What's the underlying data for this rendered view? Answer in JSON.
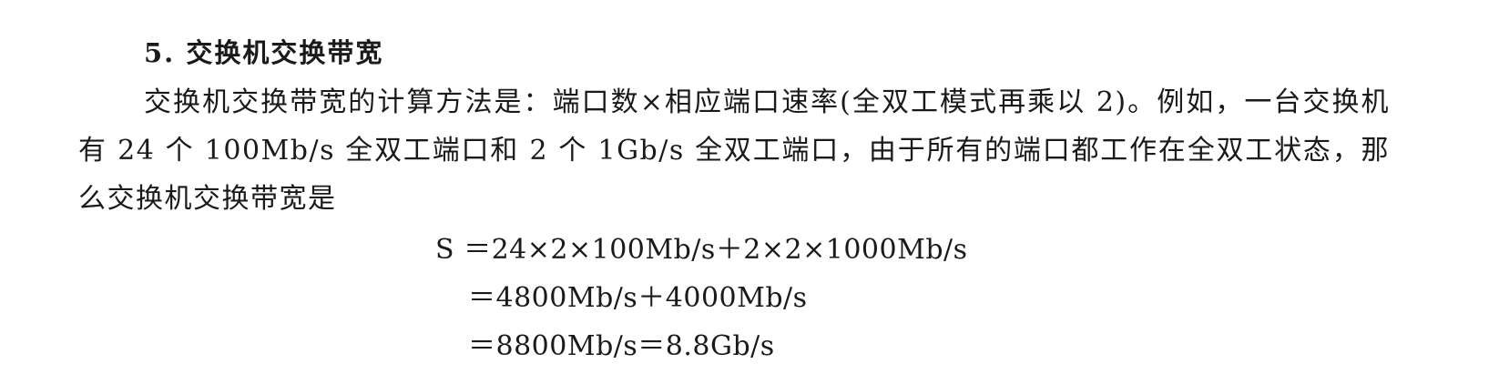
{
  "section": {
    "heading": "5. 交换机交换带宽",
    "paragraph": "交换机交换带宽的计算方法是：端口数×相应端口速率(全双工模式再乘以 2)。例如，一台交换机有 24 个 100Mb/s 全双工端口和 2 个 1Gb/s 全双工端口，由于所有的端口都工作在全双工状态，那么交换机交换带宽是"
  },
  "equations": [
    "S ＝24×2×100Mb/s＋2×2×1000Mb/s",
    "＝4800Mb/s＋4000Mb/s",
    "＝8800Mb/s＝8.8Gb/s"
  ]
}
